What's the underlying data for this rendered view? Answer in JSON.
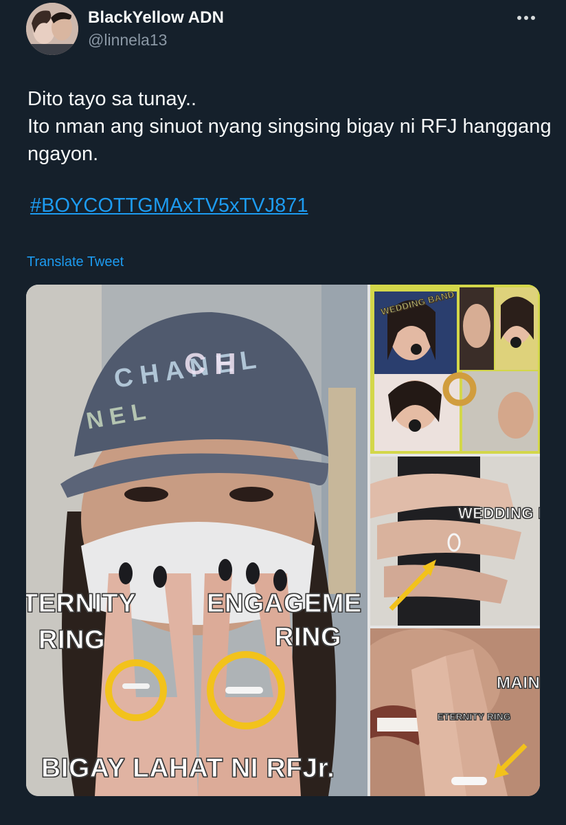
{
  "tweet": {
    "display_name": "BlackYellow ADN",
    "handle": "@linnela13",
    "text_lines": [
      "Dito tayo sa tunay..",
      "Ito nman ang sinuot nyang singsing bigay ni RFJ hanggang",
      "ngayon."
    ],
    "hashtag": "#BOYCOTTGMAxTV5xTVJ871",
    "translate_label": "Translate Tweet"
  },
  "media": {
    "main_labels": {
      "left_line1": "TERNITY",
      "left_line2": "RING",
      "right_line1": "ENGAGEME",
      "right_line2": "RING",
      "bottom": "BIGAY LAHAT NI RFJr.",
      "cap_text": "CHANEL"
    },
    "side1_label": "WEDDING BAND",
    "side2_label": "WEDDING R",
    "side3_label": "MAINE",
    "side3_sublabel": "ETERNITY RING"
  },
  "colors": {
    "background": "#15202b",
    "text": "#f7f9f9",
    "secondary": "#8b98a5",
    "link": "#1d9bf0",
    "highlight_circle": "#f2c21b"
  },
  "icons": {
    "more": "more-horizontal-icon"
  }
}
